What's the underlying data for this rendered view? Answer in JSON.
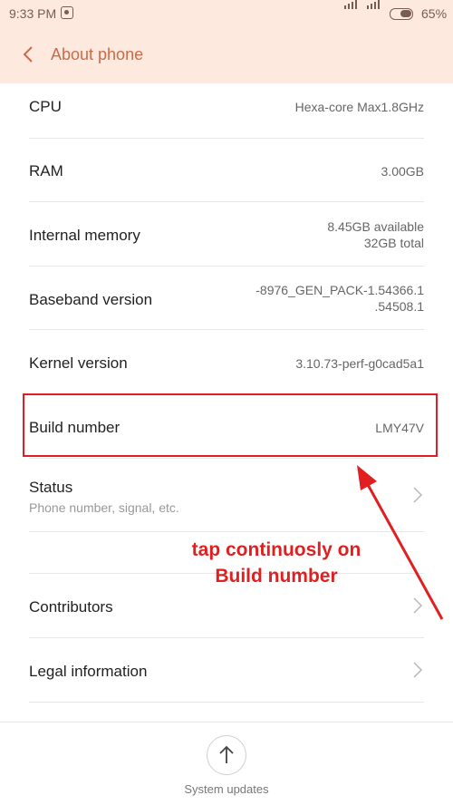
{
  "status_bar": {
    "time": "9:33 PM",
    "battery": "65%",
    "notification_icon": "android-notification-icon"
  },
  "header": {
    "title": "About phone",
    "back_icon": "back-chevron-icon"
  },
  "rows": {
    "cpu": {
      "label": "CPU",
      "value": "Hexa-core Max1.8GHz"
    },
    "ram": {
      "label": "RAM",
      "value": "3.00GB"
    },
    "internal_memory": {
      "label": "Internal memory",
      "value_line1": "8.45GB available",
      "value_line2": "32GB total"
    },
    "baseband": {
      "label": "Baseband version",
      "value_line1": "-8976_GEN_PACK-1.54366.1",
      "value_line2": ".54508.1"
    },
    "kernel": {
      "label": "Kernel version",
      "value": "3.10.73-perf-g0cad5a1"
    },
    "build": {
      "label": "Build number",
      "value": "LMY47V"
    },
    "status": {
      "label": "Status",
      "sublabel": "Phone number, signal, etc."
    },
    "contributors": {
      "label": "Contributors"
    },
    "legal": {
      "label": "Legal information"
    }
  },
  "annotation": {
    "line1": "tap continuosly on",
    "line2": "Build number",
    "color": "#e02020"
  },
  "bottom": {
    "system_updates": "System updates",
    "update_icon": "arrow-up-icon"
  },
  "colors": {
    "header_bg": "#fde9de",
    "title_accent": "#c96b4b",
    "highlight": "#e02020"
  }
}
